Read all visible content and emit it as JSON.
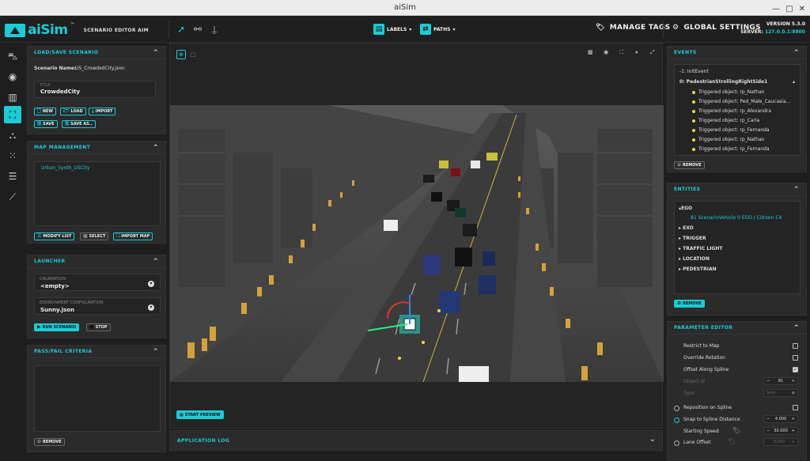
{
  "window": {
    "title": "aiSim"
  },
  "brand": {
    "logo": "aiSim",
    "tm": "™",
    "subtitle": "SCENARIO EDITOR AIM"
  },
  "toolbar": {
    "labels_dropdown": "LABELS",
    "paths_dropdown": "PATHS",
    "manage_tags": "MANAGE TAGS",
    "global_settings": "GLOBAL SETTINGS",
    "version": "VERSION 5.3.0",
    "server_label": "SERVER:",
    "server_value": "127.0.0.1:8800"
  },
  "load_save": {
    "title": "LOAD/SAVE SCENARIO",
    "scenario_name_label": "Scenario Name:",
    "scenario_name_value": "US_CrowdedCity.json",
    "title_field_label": "TITLE",
    "title_field_value": "CrowdedCity",
    "buttons": {
      "new": "NEW",
      "load": "LOAD",
      "import": "IMPORT",
      "save": "SAVE",
      "save_as": "SAVE AS.."
    }
  },
  "map_management": {
    "title": "MAP MANAGEMENT",
    "maps": [
      "Urban_Synth_USCity"
    ],
    "buttons": {
      "modify_list": "MODIFY LIST",
      "select": "SELECT",
      "import_map": "IMPORT MAP"
    }
  },
  "launcher": {
    "title": "LAUNCHER",
    "calibration_label": "CALIBRATION",
    "calibration_value": "<empty>",
    "env_label": "ENVIRONMENT CONFIGURATION",
    "env_value": "Sunny.json",
    "run": "RUN SCENARIO",
    "stop": "STOP"
  },
  "pass_fail": {
    "title": "PASS/FAIL CRITERIA",
    "remove": "REMOVE"
  },
  "viewport": {
    "start_preview": "START PREVIEW"
  },
  "app_log": {
    "title": "APPLICATION LOG"
  },
  "events": {
    "title": "EVENTS",
    "items": [
      {
        "label": "-1: InitEvent",
        "bold": false,
        "level": 0
      },
      {
        "label": "0: PedestrianStrollingRightSide1",
        "bold": true,
        "level": 0
      },
      {
        "label": "Triggered object: rp_Nathan",
        "level": 1
      },
      {
        "label": "Triggered object: Ped_Male_Caucasia...",
        "level": 1
      },
      {
        "label": "Triggered object: rp_Alexandra",
        "level": 1
      },
      {
        "label": "Triggered object: rp_Carla",
        "level": 1
      },
      {
        "label": "Triggered object: rp_Fernanda",
        "level": 1
      },
      {
        "label": "Triggered object: rp_Nathan",
        "level": 1
      },
      {
        "label": "Triggered object: rp_Fernanda",
        "level": 1
      }
    ],
    "remove": "REMOVE"
  },
  "entities": {
    "title": "ENTITIES",
    "ego": "▴EGO",
    "ego_child": "81 ScenarioVehicle 0 EGO / Citroen C4",
    "groups": [
      "▸ EXO",
      "▸ TRIGGER",
      "▸ TRAFFIC LIGHT",
      "▸ LOCATION",
      "▸ PEDESTRIAN"
    ],
    "remove": "REMOVE"
  },
  "param_editor": {
    "title": "PARAMETER EDITOR",
    "restrict_to_map": "Restrict to Map",
    "override_rotation": "Override Rotation",
    "offset_along_spline": "Offset Along Spline",
    "object_id": "Object id",
    "object_id_value": "81",
    "type": "Type",
    "type_value": "Sele...",
    "reposition_on_spline": "Reposition on Spline",
    "snap_to_spline_distance": "Snap to Spline Distance",
    "snap_value": "4.000",
    "starting_speed": "Starting Speed",
    "starting_speed_value": "30.000",
    "lane_offset": "Lane Offset",
    "lane_offset_value": "0.000"
  },
  "colors": {
    "accent": "#1ccbd6",
    "panel": "#2b2b2b",
    "background": "#1e1e1e"
  }
}
